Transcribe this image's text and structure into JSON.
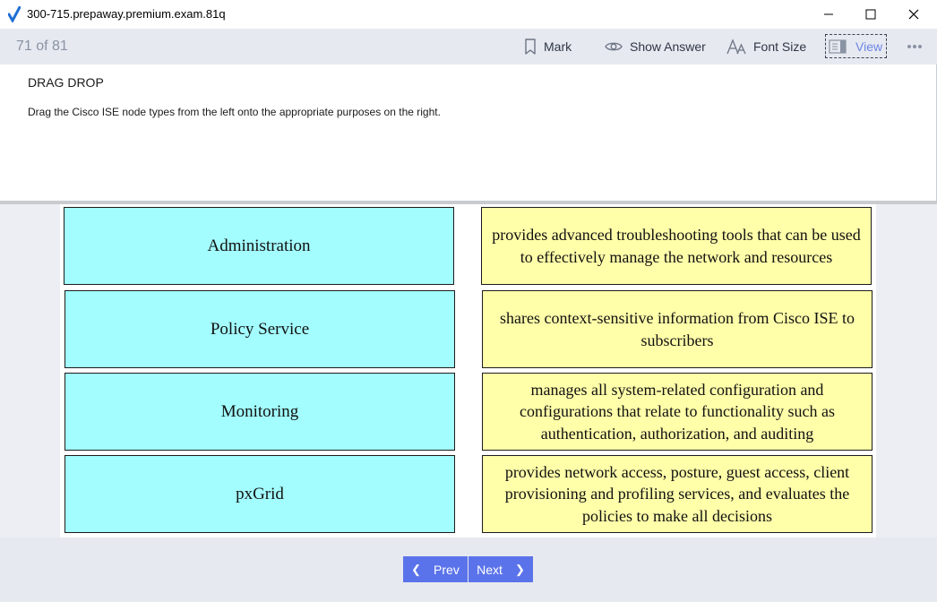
{
  "window": {
    "title": "300-715.prepaway.premium.exam.81q"
  },
  "toolbar": {
    "counter": "71 of 81",
    "mark_label": "Mark",
    "show_answer_label": "Show Answer",
    "font_size_label": "Font Size",
    "view_label": "View",
    "icons": {
      "mark": "bookmark-icon",
      "show_answer": "eye-icon",
      "font_size": "font-size-icon",
      "view": "view-layout-icon",
      "more": "more-dots-icon"
    }
  },
  "question": {
    "type": "DRAG DROP",
    "text": "Drag the Cisco ISE node types from the left onto the appropriate purposes on the right."
  },
  "exhibit": {
    "node_types": [
      "Administration",
      "Policy Service",
      "Monitoring",
      "pxGrid"
    ],
    "purposes": [
      "provides advanced troubleshooting tools that can be used to effectively manage the network and resources",
      "shares context-sensitive information from Cisco ISE to subscribers",
      "manages all system-related configuration and configurations that relate to functionality such as authentication, authorization, and auditing",
      "provides network access, posture, guest access, client provisioning and profiling services, and evaluates the policies to make all decisions"
    ]
  },
  "navigation": {
    "prev_label": "Prev",
    "next_label": "Next"
  },
  "colors": {
    "accent": "#5b73ea",
    "toolbar_bg": "#e6e9f0",
    "node_box": "#a3fcfe",
    "purpose_box": "#fffea9",
    "app_icon": "#1f6fd6"
  }
}
